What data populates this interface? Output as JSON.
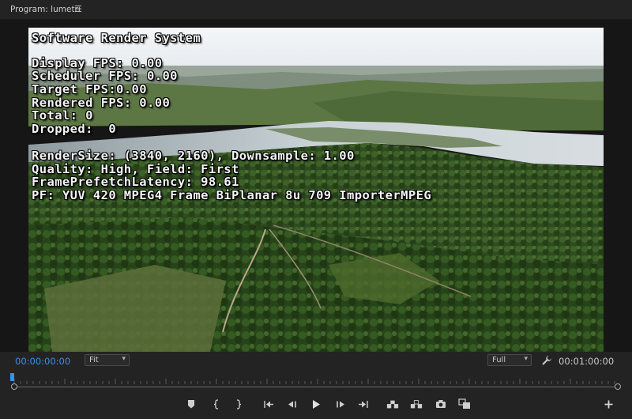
{
  "panel": {
    "title": "Program: lumetri",
    "menu_icon": "hamburger-menu-icon"
  },
  "overlay": {
    "heading": "Software Render System",
    "stats": [
      "Display FPS: 0.00",
      "Scheduler FPS: 0.00",
      "Target FPS:0.00",
      "Rendered FPS: 0.00",
      "Total: 0",
      "Dropped:  0"
    ],
    "info": [
      "RenderSize: (3840, 2160), Downsample: 1.00",
      "Quality: High, Field: First",
      "FramePrefetchLatency: 98.61",
      "PF: YUV 420 MPEG4 Frame BiPlanar 8u 709 ImporterMPEG"
    ]
  },
  "controls": {
    "current_timecode": "00:00:00:00",
    "duration_timecode": "00:01:00:00",
    "zoom_select": "Fit",
    "resolution_select": "Full",
    "accent_color": "#3b8fe8",
    "buttons": [
      {
        "name": "add-marker-button",
        "icon": "marker-icon"
      },
      {
        "name": "mark-in-button",
        "icon": "mark-in-icon"
      },
      {
        "name": "mark-out-button",
        "icon": "mark-out-icon"
      },
      {
        "name": "go-to-in-button",
        "icon": "go-to-in-icon"
      },
      {
        "name": "step-back-button",
        "icon": "step-back-icon"
      },
      {
        "name": "play-button",
        "icon": "play-icon"
      },
      {
        "name": "step-forward-button",
        "icon": "step-forward-icon"
      },
      {
        "name": "go-to-out-button",
        "icon": "go-to-out-icon"
      },
      {
        "name": "lift-button",
        "icon": "lift-icon"
      },
      {
        "name": "extract-button",
        "icon": "extract-icon"
      },
      {
        "name": "export-frame-button",
        "icon": "camera-icon"
      },
      {
        "name": "comparison-view-button",
        "icon": "comparison-icon"
      },
      {
        "name": "button-editor-button",
        "icon": "plus-icon"
      }
    ]
  }
}
